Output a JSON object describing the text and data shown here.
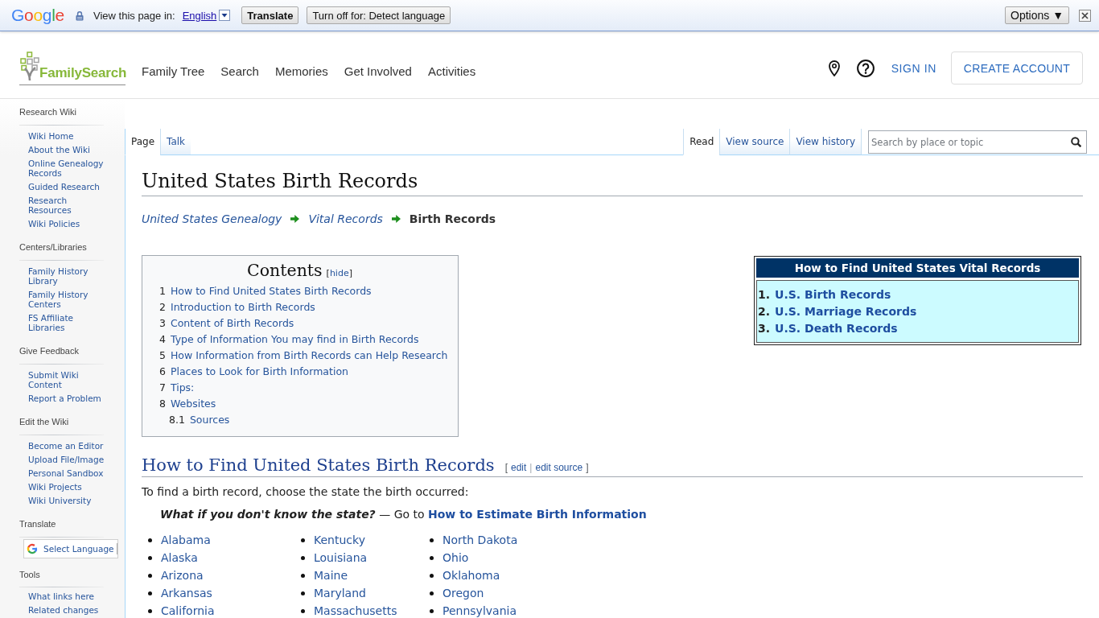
{
  "translate_bar": {
    "logo": "Google",
    "prompt": "View this page in:",
    "language": "English",
    "buttons": [
      {
        "kind": "strong",
        "label": "Translate"
      },
      {
        "kind": "plain",
        "label": "Turn off for: Detect language"
      }
    ],
    "options": "Options ▼"
  },
  "header": {
    "logo": "FamilySearch",
    "nav": [
      "Family Tree",
      "Search",
      "Memories",
      "Get Involved",
      "Activities"
    ],
    "sign_in": "SIGN IN",
    "create_account": "CREATE ACCOUNT"
  },
  "sidebar": [
    {
      "kind": "links",
      "heading": "Research Wiki",
      "items": [
        "Wiki Home",
        "About the Wiki",
        "Online Genealogy Records",
        "Guided Research",
        "Research Resources",
        "Wiki Policies"
      ]
    },
    {
      "kind": "links",
      "heading": "Centers/Libraries",
      "items": [
        "Family History Library",
        "Family History Centers",
        "FS Affiliate Libraries"
      ]
    },
    {
      "kind": "links",
      "heading": "Give Feedback",
      "items": [
        "Submit Wiki Content",
        "Report a Problem"
      ]
    },
    {
      "kind": "links",
      "heading": "Edit the Wiki",
      "items": [
        "Become an Editor",
        "Upload File/Image",
        "Personal Sandbox",
        "Wiki Projects",
        "Wiki University"
      ]
    },
    {
      "kind": "language",
      "heading": "Translate",
      "widget": "Select Language"
    },
    {
      "kind": "links",
      "heading": "Tools",
      "items": [
        "What links here",
        "Related changes"
      ]
    }
  ],
  "tabs": {
    "namespaces": [
      {
        "label": "Page",
        "selected": true
      },
      {
        "label": "Talk",
        "selected": false
      }
    ],
    "views": [
      {
        "label": "Read",
        "selected": true
      },
      {
        "label": "View source",
        "selected": false
      },
      {
        "label": "View history",
        "selected": false
      }
    ]
  },
  "search": {
    "placeholder": "Search by place or topic"
  },
  "article": {
    "title": "United States Birth Records",
    "breadcrumb": [
      {
        "label": "United States Genealogy",
        "current": false
      },
      {
        "label": "Vital Records",
        "current": false
      },
      {
        "label": "Birth Records",
        "current": true
      }
    ],
    "toc": {
      "title": "Contents",
      "toggle": {
        "open": "[",
        "label": "hide",
        "close": "]"
      },
      "items": [
        {
          "number": "1",
          "label": "How to Find United States Birth Records"
        },
        {
          "number": "2",
          "label": "Introduction to Birth Records"
        },
        {
          "number": "3",
          "label": "Content of Birth Records"
        },
        {
          "number": "4",
          "label": "Type of Information You may find in Birth Records"
        },
        {
          "number": "5",
          "label": "How Information from Birth Records can Help Research"
        },
        {
          "number": "6",
          "label": "Places to Look for Birth Information"
        },
        {
          "number": "7",
          "label": "Tips:"
        },
        {
          "number": "8",
          "label": "Websites",
          "children": [
            {
              "number": "8.1",
              "label": "Sources"
            }
          ]
        }
      ]
    },
    "infobox": {
      "title": "How to Find United States Vital Records",
      "items": [
        {
          "number": "1.",
          "label": "U.S. Birth Records"
        },
        {
          "number": "2.",
          "label": "U.S. Marriage Records"
        },
        {
          "number": "3.",
          "label": "U.S. Death Records"
        }
      ]
    },
    "section": {
      "heading": "How to Find United States Birth Records",
      "edit": {
        "open": "[",
        "links": [
          "edit",
          "edit source"
        ],
        "separator": "|",
        "close": "]"
      },
      "intro": "To find a birth record, choose the state the birth occurred:",
      "hint": {
        "question": "What if you don't know the state?",
        "text": "— Go to",
        "link": "How to Estimate Birth Information"
      },
      "state_columns": [
        [
          "Alabama",
          "Alaska",
          "Arizona",
          "Arkansas",
          "California"
        ],
        [
          "Kentucky",
          "Louisiana",
          "Maine",
          "Maryland",
          "Massachusetts"
        ],
        [
          "North Dakota",
          "Ohio",
          "Oklahoma",
          "Oregon",
          "Pennsylvania"
        ]
      ]
    }
  }
}
